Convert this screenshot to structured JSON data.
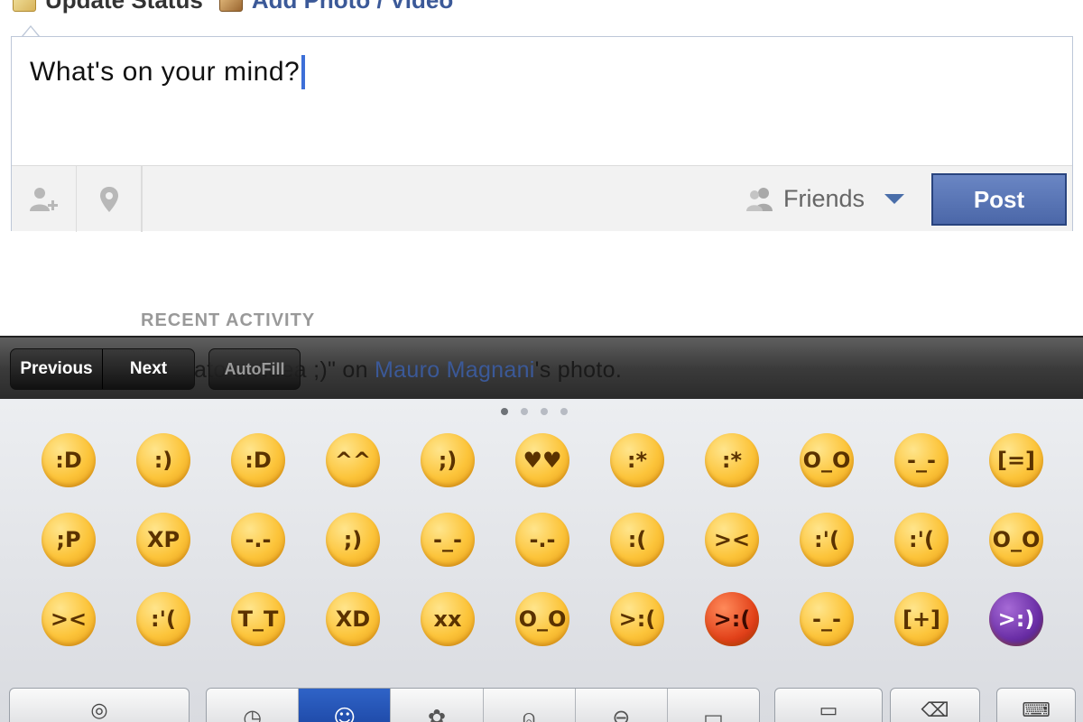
{
  "composer": {
    "tabs": [
      {
        "label": "Update Status",
        "icon": "pencil-icon"
      },
      {
        "label": "Add Photo / Video",
        "icon": "photo-icon"
      }
    ],
    "placeholder": "What's on your mind?",
    "audience_label": "Friends",
    "post_label": "Post",
    "tag_icon": "add-person-icon",
    "location_icon": "location-pin-icon"
  },
  "recent_activity_label": "RECENT ACTIVITY",
  "feed_snippet": {
    "text_prefix": "ato un'idea ;)\" on ",
    "link": "Mauro Magnani",
    "suffix": "'s photo."
  },
  "keyboard_toolbar": {
    "previous_label": "Previous",
    "next_label": "Next",
    "autofill_label": "AutoFill"
  },
  "emoji_keyboard": {
    "page_count": 4,
    "active_page": 1,
    "emoji_rows": [
      [
        ":D",
        ":)",
        ":D",
        "^^",
        ";)",
        "♥♥",
        ":*",
        ":*",
        "O_O",
        "-_-",
        "[=]"
      ],
      [
        ";P",
        "XP",
        "-.-",
        ";)",
        "-_-",
        "-.-",
        ":(",
        "><",
        ":'(",
        ":'(",
        "O_O"
      ],
      [
        "><",
        ":'(",
        "T_T",
        "XD",
        "xx",
        "O_O",
        ">:(",
        ">:(",
        "-_-",
        "[+]",
        ">:)"
      ]
    ],
    "categories": [
      "clock",
      "smiley",
      "flower",
      "bell",
      "car",
      "symbols"
    ],
    "active_category": "smiley"
  },
  "colors": {
    "facebook_blue": "#3b5998",
    "post_button": "#4b67a8",
    "cursor": "#3d6fd8",
    "active_category": "#2f63c7"
  }
}
